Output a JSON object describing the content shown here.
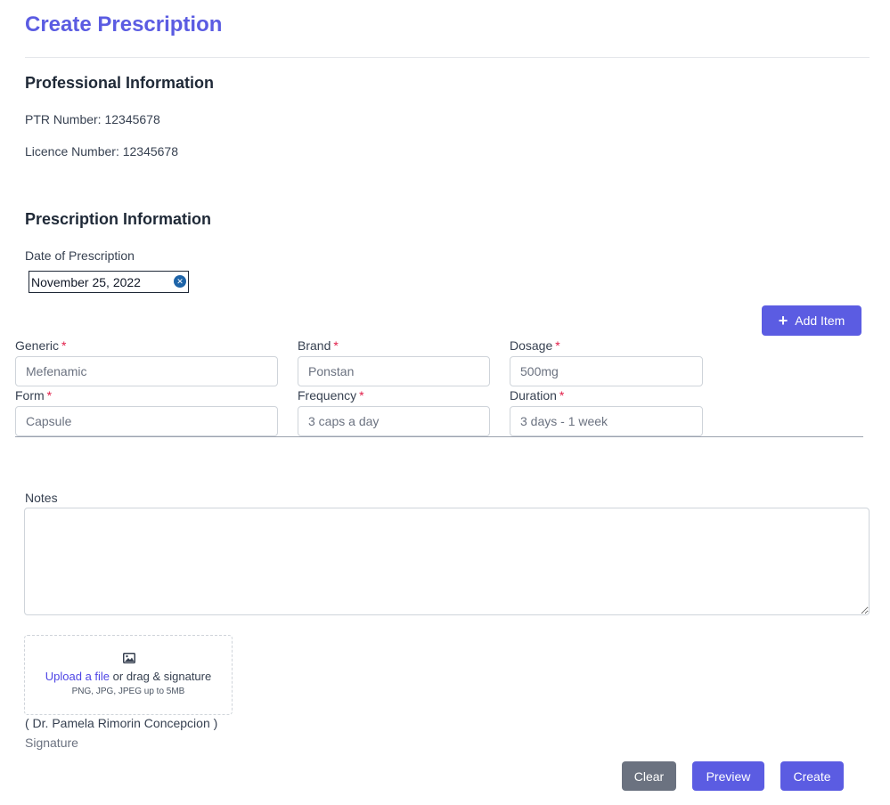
{
  "page": {
    "title": "Create Prescription"
  },
  "professional": {
    "heading": "Professional Information",
    "ptr_line": "PTR Number: 12345678",
    "licence_line": "Licence Number: 12345678"
  },
  "prescription": {
    "heading": "Prescription Information",
    "date_label": "Date of Prescription",
    "date_value": "November 25, 2022"
  },
  "item_form": {
    "add_item_label": "Add Item",
    "required_marker": "*",
    "generic_label": "Generic",
    "generic_placeholder": "Mefenamic",
    "brand_label": "Brand",
    "brand_placeholder": "Ponstan",
    "dosage_label": "Dosage",
    "dosage_placeholder": "500mg",
    "form_label": "Form",
    "form_placeholder": "Capsule",
    "frequency_label": "Frequency",
    "frequency_placeholder": "3 caps a day",
    "duration_label": "Duration",
    "duration_placeholder": "3 days - 1 week"
  },
  "notes": {
    "label": "Notes",
    "value": ""
  },
  "signature": {
    "upload_link": "Upload a file",
    "upload_text": " or drag & signature",
    "upload_hint": "PNG, JPG, JPEG up to 5MB",
    "doctor_name": "( Dr. Pamela Rimorin Concepcion )",
    "caption": "Signature"
  },
  "actions": {
    "clear_label": "Clear",
    "preview_label": "Preview",
    "create_label": "Create"
  },
  "colors": {
    "accent": "#5b5ce2",
    "secondary_button": "#6b7280",
    "required": "#e11d48",
    "link": "#4f46e5"
  },
  "icons": {
    "add_item": "plus-icon",
    "clear_date": "close-circle-icon",
    "upload": "image-icon"
  }
}
